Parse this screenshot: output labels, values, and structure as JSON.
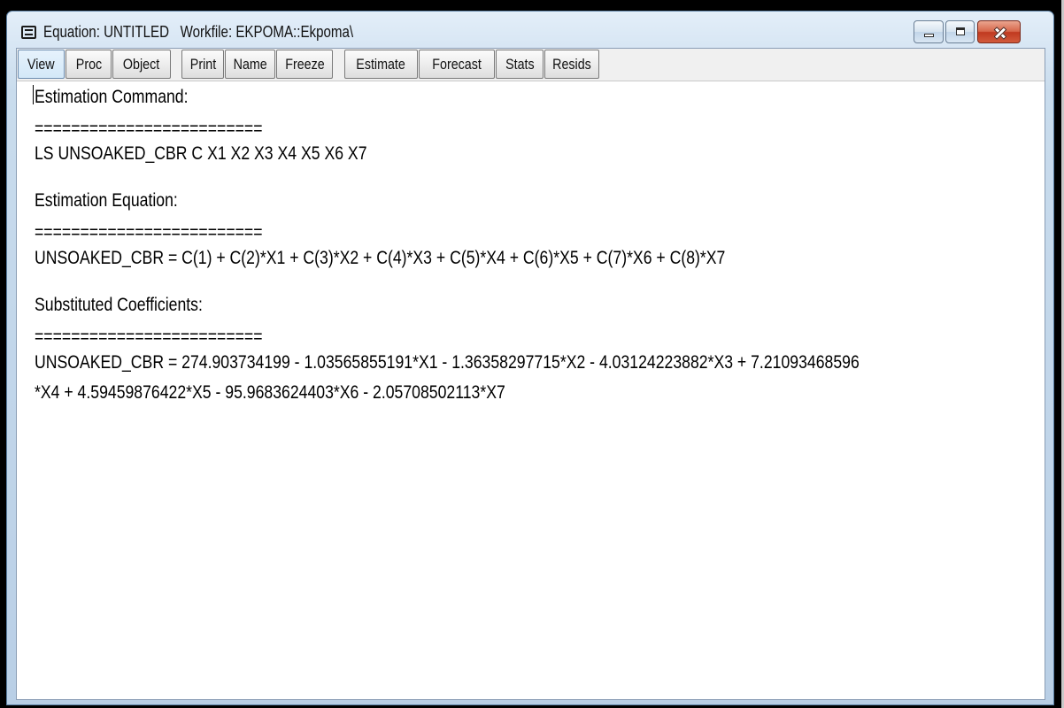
{
  "window": {
    "title": "Equation: UNTITLED   Workfile: EKPOMA::Ekpoma\\"
  },
  "toolbar": {
    "view": "View",
    "proc": "Proc",
    "object": "Object",
    "print": "Print",
    "name": "Name",
    "freeze": "Freeze",
    "estimate": "Estimate",
    "forecast": "Forecast",
    "stats": "Stats",
    "resids": "Resids"
  },
  "content": {
    "estimation_command_heading": "Estimation Command:",
    "separator_1": "=========================",
    "command": "LS UNSOAKED_CBR C X1 X2 X3 X4 X5 X6 X7",
    "estimation_equation_heading": "Estimation Equation:",
    "separator_2": "=========================",
    "equation": "UNSOAKED_CBR = C(1) + C(2)*X1 + C(3)*X2 + C(4)*X3 + C(5)*X4 + C(6)*X5 + C(7)*X6 + C(8)*X7",
    "substituted_heading": "Substituted Coefficients:",
    "separator_3": "=========================",
    "substituted_line_1": "UNSOAKED_CBR = 274.903734199 - 1.03565855191*X1 - 1.36358297715*X2 - 4.03124223882*X3 + 7.21093468596",
    "substituted_line_2": "*X4 + 4.59459876422*X5 - 95.9683624403*X6 - 2.05708502113*X7"
  }
}
